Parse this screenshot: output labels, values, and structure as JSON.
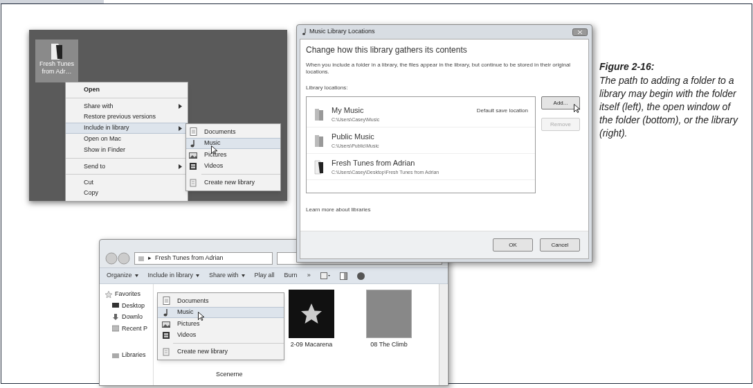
{
  "desktop": {
    "icon_label": [
      "Fresh Tunes",
      "from Adr…"
    ],
    "context_menu": [
      {
        "label": "Open",
        "bold": true,
        "submenu": false,
        "selected": false,
        "group_start": false
      },
      {
        "label": "Share with",
        "bold": false,
        "submenu": true,
        "selected": false,
        "group_start": true
      },
      {
        "label": "Restore previous versions",
        "bold": false,
        "submenu": false,
        "selected": false,
        "group_start": false
      },
      {
        "label": "Include in library",
        "bold": false,
        "submenu": true,
        "selected": true,
        "group_start": false
      },
      {
        "label": "Open on Mac",
        "bold": false,
        "submenu": false,
        "selected": false,
        "group_start": false
      },
      {
        "label": "Show in Finder",
        "bold": false,
        "submenu": false,
        "selected": false,
        "group_start": false
      },
      {
        "label": "Send to",
        "bold": false,
        "submenu": true,
        "selected": false,
        "group_start": true
      },
      {
        "label": "Cut",
        "bold": false,
        "submenu": false,
        "selected": false,
        "group_start": true
      },
      {
        "label": "Copy",
        "bold": false,
        "submenu": false,
        "selected": false,
        "group_start": false
      }
    ],
    "submenu": [
      {
        "kind": "documents",
        "label": "Documents",
        "selected": false
      },
      {
        "kind": "music",
        "label": "Music",
        "selected": true
      },
      {
        "kind": "pictures",
        "label": "Pictures",
        "selected": false
      },
      {
        "kind": "videos",
        "label": "Videos",
        "selected": false
      },
      {
        "kind": "new",
        "label": "Create new library",
        "selected": false
      }
    ]
  },
  "dialog": {
    "title": "Music Library Locations",
    "heading": "Change how this library gathers its contents",
    "description": "When you include a folder in a library, the files appear in the library, but continue to be stored in their original locations.",
    "section_label": "Library locations:",
    "locations": [
      {
        "kind": "library",
        "name": "My Music",
        "path": "C:\\Users\\Casey\\Music",
        "note": "Default save location"
      },
      {
        "kind": "library",
        "name": "Public Music",
        "path": "C:\\Users\\Public\\Music"
      },
      {
        "kind": "folder",
        "name": "Fresh Tunes from Adrian",
        "path": "C:\\Users\\Casey\\Desktop\\Fresh Tunes from Adrian"
      }
    ],
    "side_buttons": [
      {
        "label": "Add...",
        "disabled": false
      },
      {
        "label": "Remove",
        "disabled": true
      }
    ],
    "link": "Learn more about libraries",
    "footer_buttons": [
      "OK",
      "Cancel"
    ]
  },
  "explorer": {
    "address_separator": "▸",
    "address": "Fresh Tunes from Adrian",
    "toolbar": [
      {
        "label": "Organize",
        "dropdown": true
      },
      {
        "label": "Include in library",
        "dropdown": true
      },
      {
        "label": "Share with",
        "dropdown": true
      },
      {
        "label": "Play all",
        "dropdown": false
      },
      {
        "label": "Burn",
        "dropdown": false
      },
      {
        "label": "»",
        "dropdown": false
      }
    ],
    "nav": [
      {
        "kind": "favorites",
        "label": "Favorites"
      },
      {
        "kind": "desktop",
        "label": "Desktop"
      },
      {
        "kind": "downloads",
        "label": "Downlo"
      },
      {
        "kind": "recent",
        "label": "Recent P"
      },
      {
        "kind": "libraries",
        "label": "Libraries"
      }
    ],
    "dropdown": [
      {
        "kind": "documents",
        "label": "Documents",
        "selected": false
      },
      {
        "kind": "music",
        "label": "Music",
        "selected": true
      },
      {
        "kind": "pictures",
        "label": "Pictures",
        "selected": false
      },
      {
        "kind": "videos",
        "label": "Videos",
        "selected": false
      },
      {
        "kind": "new",
        "label": "Create new library",
        "selected": false
      }
    ],
    "items": [
      {
        "kind": "album",
        "caption": "2-09 Macarena"
      },
      {
        "kind": "photo",
        "caption": "08 The Climb"
      }
    ],
    "partial_caption": "Scenerne"
  },
  "caption": {
    "title": "Figure 2-16:",
    "text": "The path to adding a folder to a library may begin with the folder itself (left), the open window of the folder (bottom), or the library (right)."
  }
}
